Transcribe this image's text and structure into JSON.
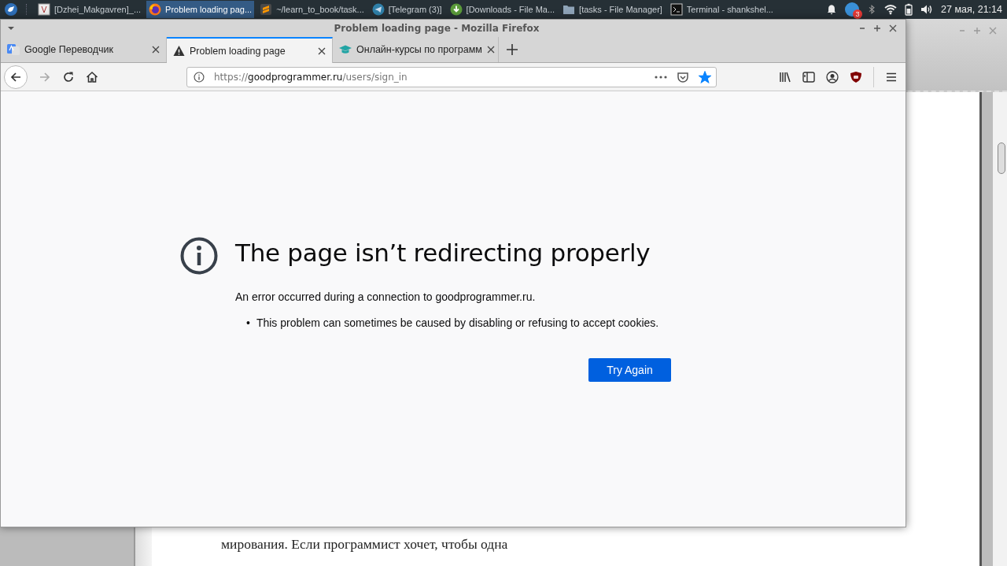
{
  "taskbar": {
    "items": [
      {
        "kind": "book",
        "label": "[Dzhei_Makgavren]_...",
        "selected": false
      },
      {
        "kind": "firefox",
        "label": "Problem loading pag...",
        "selected": true
      },
      {
        "kind": "sublime",
        "label": "~/learn_to_book/task...",
        "selected": false
      },
      {
        "kind": "telegram",
        "label": "[Telegram (3)]",
        "selected": false
      },
      {
        "kind": "download",
        "label": "[Downloads - File Ma...",
        "selected": false
      },
      {
        "kind": "folder",
        "label": "[tasks - File Manager]",
        "selected": false
      },
      {
        "kind": "terminal",
        "label": "Terminal - shankshel...",
        "selected": false
      }
    ],
    "notification_count": "3",
    "clock": "27 мая, 21:14"
  },
  "background_window": {
    "text_lines": [
      "мирования. Если программист хочет, чтобы одна"
    ]
  },
  "browser": {
    "title": "Problem loading page - Mozilla Firefox",
    "tabs": [
      {
        "kind": "translate",
        "label": "Google Переводчик",
        "selected": false
      },
      {
        "kind": "warning",
        "label": "Problem loading page",
        "selected": true
      },
      {
        "kind": "course",
        "label": "Онлайн-курсы по программ",
        "selected": false
      }
    ],
    "forward_disabled": true,
    "url": {
      "scheme": "https://",
      "domain": "goodprogrammer.ru",
      "path": "/users/sign_in"
    },
    "bookmarked": true,
    "error": {
      "title": "The page isn’t redirecting properly",
      "message": "An error occurred during a connection to goodprogrammer.ru.",
      "bullets": [
        {
          "marker": "•",
          "text": "This problem can sometimes be caused by disabling or refusing to accept cookies."
        }
      ],
      "button": "Try Again"
    }
  }
}
